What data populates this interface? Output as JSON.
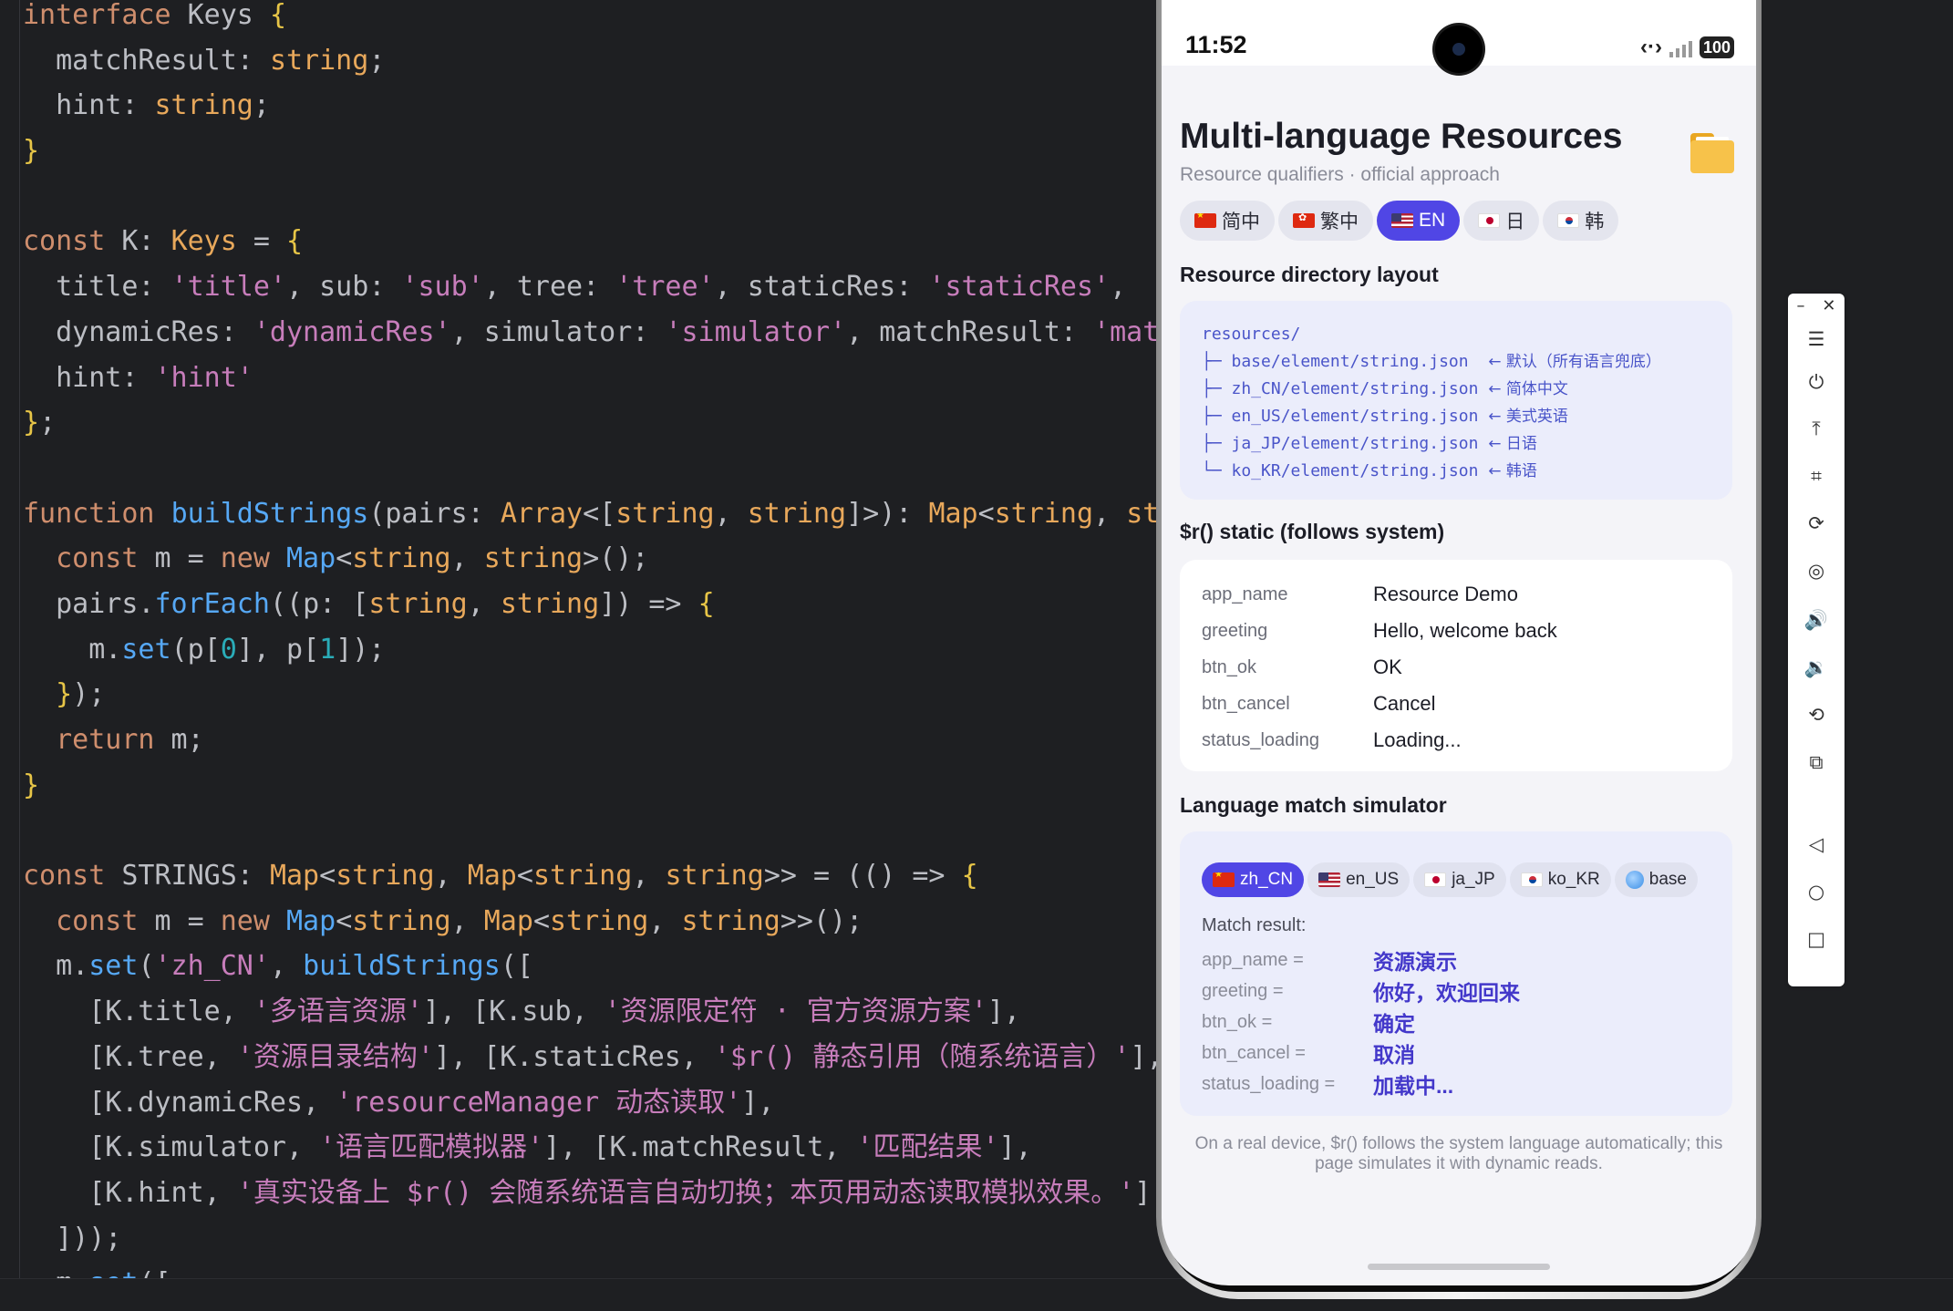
{
  "editor": {
    "lines": [
      [
        [
          "kw",
          "interface"
        ],
        [
          "plain",
          " Keys "
        ],
        [
          "brace",
          "{"
        ]
      ],
      [
        [
          "prop",
          "  matchResult"
        ],
        [
          "punc",
          ": "
        ],
        [
          "type",
          "string"
        ],
        [
          "punc",
          ";"
        ]
      ],
      [
        [
          "prop",
          "  hint"
        ],
        [
          "punc",
          ": "
        ],
        [
          "type",
          "string"
        ],
        [
          "punc",
          ";"
        ]
      ],
      [
        [
          "brace",
          "}"
        ]
      ],
      [],
      [
        [
          "kw",
          "const"
        ],
        [
          "plain",
          " K"
        ],
        [
          "punc",
          ": "
        ],
        [
          "type",
          "Keys"
        ],
        [
          "punc",
          " = "
        ],
        [
          "brace",
          "{"
        ]
      ],
      [
        [
          "prop",
          "  title"
        ],
        [
          "punc",
          ": "
        ],
        [
          "str",
          "'title'"
        ],
        [
          "punc",
          ", "
        ],
        [
          "prop",
          "sub"
        ],
        [
          "punc",
          ": "
        ],
        [
          "str",
          "'sub'"
        ],
        [
          "punc",
          ", "
        ],
        [
          "prop",
          "tree"
        ],
        [
          "punc",
          ": "
        ],
        [
          "str",
          "'tree'"
        ],
        [
          "punc",
          ", "
        ],
        [
          "prop",
          "staticRes"
        ],
        [
          "punc",
          ": "
        ],
        [
          "str",
          "'staticRes'"
        ],
        [
          "punc",
          ","
        ]
      ],
      [
        [
          "prop",
          "  dynamicRes"
        ],
        [
          "punc",
          ": "
        ],
        [
          "str",
          "'dynamicRes'"
        ],
        [
          "punc",
          ", "
        ],
        [
          "prop",
          "simulator"
        ],
        [
          "punc",
          ": "
        ],
        [
          "str",
          "'simulator'"
        ],
        [
          "punc",
          ", "
        ],
        [
          "prop",
          "matchResult"
        ],
        [
          "punc",
          ": "
        ],
        [
          "str",
          "'mat"
        ]
      ],
      [
        [
          "prop",
          "  hint"
        ],
        [
          "punc",
          ": "
        ],
        [
          "str",
          "'hint'"
        ]
      ],
      [
        [
          "brace",
          "}"
        ],
        [
          "punc",
          ";"
        ]
      ],
      [],
      [
        [
          "kw",
          "function"
        ],
        [
          "plain",
          " "
        ],
        [
          "fn",
          "buildStrings"
        ],
        [
          "punc",
          "("
        ],
        [
          "plain",
          "pairs"
        ],
        [
          "punc",
          ": "
        ],
        [
          "type",
          "Array"
        ],
        [
          "punc",
          "<["
        ],
        [
          "type",
          "string"
        ],
        [
          "punc",
          ", "
        ],
        [
          "type",
          "string"
        ],
        [
          "punc",
          "]>): "
        ],
        [
          "type",
          "Map"
        ],
        [
          "punc",
          "<"
        ],
        [
          "type",
          "string"
        ],
        [
          "punc",
          ", "
        ],
        [
          "type",
          "st"
        ]
      ],
      [
        [
          "kw",
          "  const"
        ],
        [
          "plain",
          " m "
        ],
        [
          "punc",
          "= "
        ],
        [
          "kw",
          "new"
        ],
        [
          "plain",
          " "
        ],
        [
          "fn",
          "Map"
        ],
        [
          "punc",
          "<"
        ],
        [
          "type",
          "string"
        ],
        [
          "punc",
          ", "
        ],
        [
          "type",
          "string"
        ],
        [
          "punc",
          ">();"
        ]
      ],
      [
        [
          "plain",
          "  pairs."
        ],
        [
          "fn",
          "forEach"
        ],
        [
          "punc",
          "(("
        ],
        [
          "plain",
          "p"
        ],
        [
          "punc",
          ": ["
        ],
        [
          "type",
          "string"
        ],
        [
          "punc",
          ", "
        ],
        [
          "type",
          "string"
        ],
        [
          "punc",
          "]) => "
        ],
        [
          "brace",
          "{"
        ]
      ],
      [
        [
          "plain",
          "    m."
        ],
        [
          "fn",
          "set"
        ],
        [
          "punc",
          "("
        ],
        [
          "plain",
          "p"
        ],
        [
          "punc",
          "["
        ],
        [
          "num",
          "0"
        ],
        [
          "punc",
          "], "
        ],
        [
          "plain",
          "p"
        ],
        [
          "punc",
          "["
        ],
        [
          "num",
          "1"
        ],
        [
          "punc",
          "]);"
        ]
      ],
      [
        [
          "brace",
          "  }"
        ],
        [
          "punc",
          ");"
        ]
      ],
      [
        [
          "kw",
          "  return"
        ],
        [
          "plain",
          " m"
        ],
        [
          "punc",
          ";"
        ]
      ],
      [
        [
          "brace",
          "}"
        ]
      ],
      [],
      [
        [
          "kw",
          "const"
        ],
        [
          "plain",
          " STRINGS"
        ],
        [
          "punc",
          ": "
        ],
        [
          "type",
          "Map"
        ],
        [
          "punc",
          "<"
        ],
        [
          "type",
          "string"
        ],
        [
          "punc",
          ", "
        ],
        [
          "type",
          "Map"
        ],
        [
          "punc",
          "<"
        ],
        [
          "type",
          "string"
        ],
        [
          "punc",
          ", "
        ],
        [
          "type",
          "string"
        ],
        [
          "punc",
          ">> = (() => "
        ],
        [
          "brace",
          "{"
        ]
      ],
      [
        [
          "kw",
          "  const"
        ],
        [
          "plain",
          " m "
        ],
        [
          "punc",
          "= "
        ],
        [
          "kw",
          "new"
        ],
        [
          "plain",
          " "
        ],
        [
          "fn",
          "Map"
        ],
        [
          "punc",
          "<"
        ],
        [
          "type",
          "string"
        ],
        [
          "punc",
          ", "
        ],
        [
          "type",
          "Map"
        ],
        [
          "punc",
          "<"
        ],
        [
          "type",
          "string"
        ],
        [
          "punc",
          ", "
        ],
        [
          "type",
          "string"
        ],
        [
          "punc",
          ">>();"
        ]
      ],
      [
        [
          "plain",
          "  m."
        ],
        [
          "fn",
          "set"
        ],
        [
          "punc",
          "("
        ],
        [
          "str",
          "'zh_CN'"
        ],
        [
          "punc",
          ", "
        ],
        [
          "fn",
          "buildStrings"
        ],
        [
          "punc",
          "(["
        ]
      ],
      [
        [
          "punc",
          "    ["
        ],
        [
          "plain",
          "K.title"
        ],
        [
          "punc",
          ", "
        ],
        [
          "str",
          "'多语言资源'"
        ],
        [
          "punc",
          "], ["
        ],
        [
          "plain",
          "K.sub"
        ],
        [
          "punc",
          ", "
        ],
        [
          "str",
          "'资源限定符 · 官方资源方案'"
        ],
        [
          "punc",
          "],"
        ]
      ],
      [
        [
          "punc",
          "    ["
        ],
        [
          "plain",
          "K.tree"
        ],
        [
          "punc",
          ", "
        ],
        [
          "str",
          "'资源目录结构'"
        ],
        [
          "punc",
          "], ["
        ],
        [
          "plain",
          "K.staticRes"
        ],
        [
          "punc",
          ", "
        ],
        [
          "str",
          "'$r() 静态引用（随系统语言）'"
        ],
        [
          "punc",
          "],"
        ]
      ],
      [
        [
          "punc",
          "    ["
        ],
        [
          "plain",
          "K.dynamicRes"
        ],
        [
          "punc",
          ", "
        ],
        [
          "str",
          "'resourceManager 动态读取'"
        ],
        [
          "punc",
          "],"
        ]
      ],
      [
        [
          "punc",
          "    ["
        ],
        [
          "plain",
          "K.simulator"
        ],
        [
          "punc",
          ", "
        ],
        [
          "str",
          "'语言匹配模拟器'"
        ],
        [
          "punc",
          "], ["
        ],
        [
          "plain",
          "K.matchResult"
        ],
        [
          "punc",
          ", "
        ],
        [
          "str",
          "'匹配结果'"
        ],
        [
          "punc",
          "],"
        ]
      ],
      [
        [
          "punc",
          "    ["
        ],
        [
          "plain",
          "K.hint"
        ],
        [
          "punc",
          ", "
        ],
        [
          "str",
          "'真实设备上 $r() 会随系统语言自动切换；本页用动态读取模拟效果。'"
        ],
        [
          "punc",
          "]"
        ]
      ],
      [
        [
          "punc",
          "  ]));"
        ]
      ],
      [
        [
          "plain",
          "  m."
        ],
        [
          "fn",
          "set"
        ],
        [
          "punc",
          "(["
        ]
      ]
    ]
  },
  "phone": {
    "status": {
      "time": "11:52",
      "battery": "100"
    },
    "title": "Multi-language Resources",
    "subtitle": "Resource qualifiers · official approach",
    "lang_tabs": [
      {
        "flag": "cn",
        "label": "简中",
        "active": false
      },
      {
        "flag": "hk",
        "label": "繁中",
        "active": false
      },
      {
        "flag": "us",
        "label": "EN",
        "active": true
      },
      {
        "flag": "jp",
        "label": "日",
        "active": false
      },
      {
        "flag": "kr",
        "label": "韩",
        "active": false
      }
    ],
    "tree_section_title": "Resource directory layout",
    "tree": [
      {
        "path": "resources/",
        "note": ""
      },
      {
        "path": "├─ base/element/string.json  ",
        "note": "← 默认（所有语言兜底）"
      },
      {
        "path": "├─ zh_CN/element/string.json ",
        "note": "← 简体中文"
      },
      {
        "path": "├─ en_US/element/string.json ",
        "note": "← 美式英语"
      },
      {
        "path": "├─ ja_JP/element/string.json ",
        "note": "← 日语"
      },
      {
        "path": "└─ ko_KR/element/string.json ",
        "note": "← 韩语"
      }
    ],
    "static_section_title": "$r() static (follows system)",
    "static_rows": [
      {
        "key": "app_name",
        "value": "Resource Demo"
      },
      {
        "key": "greeting",
        "value": "Hello, welcome back"
      },
      {
        "key": "btn_ok",
        "value": "OK"
      },
      {
        "key": "btn_cancel",
        "value": "Cancel"
      },
      {
        "key": "status_loading",
        "value": "Loading..."
      }
    ],
    "sim_section_title": "Language match simulator",
    "sim_tabs": [
      {
        "flag": "cn",
        "label": "zh_CN",
        "active": true
      },
      {
        "flag": "us",
        "label": "en_US",
        "active": false
      },
      {
        "flag": "jp",
        "label": "ja_JP",
        "active": false
      },
      {
        "flag": "kr",
        "label": "ko_KR",
        "active": false
      },
      {
        "flag": "globe",
        "label": "base",
        "active": false
      }
    ],
    "match_label": "Match result:",
    "match_rows": [
      {
        "key": "app_name =",
        "value": "资源演示"
      },
      {
        "key": "greeting =",
        "value": "你好，欢迎回来"
      },
      {
        "key": "btn_ok =",
        "value": "确定"
      },
      {
        "key": "btn_cancel =",
        "value": "取消"
      },
      {
        "key": "status_loading =",
        "value": "加载中..."
      }
    ],
    "footer_note": "On a real device, $r() follows the system language automatically; this page simulates it with dynamic reads."
  },
  "toolbar": {
    "minimize": "–",
    "close": "✕",
    "buttons": [
      {
        "name": "menu-icon",
        "glyph": "☰"
      },
      {
        "name": "power-icon",
        "glyph": "⏻"
      },
      {
        "name": "pin-top-icon",
        "glyph": "⤒"
      },
      {
        "name": "crop-icon",
        "glyph": "⌗"
      },
      {
        "name": "rotate-icon",
        "glyph": "⟳"
      },
      {
        "name": "location-icon",
        "glyph": "◎"
      },
      {
        "name": "volume-up-icon",
        "glyph": "🔊"
      },
      {
        "name": "volume-down-icon",
        "glyph": "🔉"
      },
      {
        "name": "screen-rotate-icon",
        "glyph": "⟲"
      },
      {
        "name": "multi-screen-icon",
        "glyph": "⧉"
      },
      {
        "name": "back-icon",
        "glyph": "◁"
      },
      {
        "name": "home-icon",
        "glyph": "○"
      },
      {
        "name": "recents-icon",
        "glyph": "□"
      }
    ]
  },
  "colors": {
    "accent": "#5046e5",
    "editor_bg": "#1e1f22"
  }
}
